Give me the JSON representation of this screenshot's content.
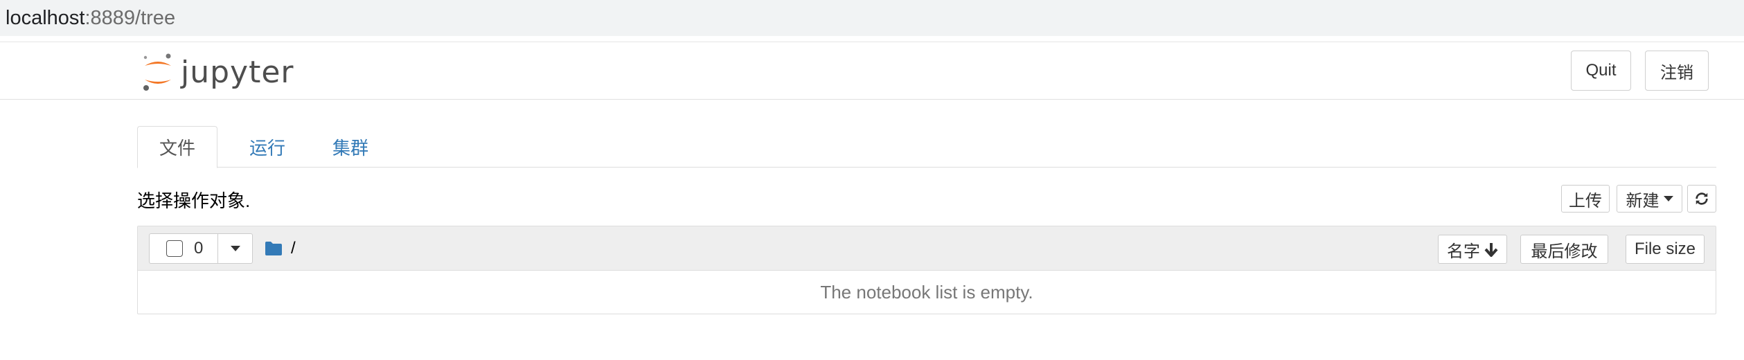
{
  "browser": {
    "url_host": "localhost",
    "url_rest": ":8889/tree"
  },
  "header": {
    "logo_text": "jupyter",
    "quit_label": "Quit",
    "logout_label": "注销"
  },
  "tabs": [
    {
      "label": "文件",
      "active": true
    },
    {
      "label": "运行",
      "active": false
    },
    {
      "label": "集群",
      "active": false
    }
  ],
  "toolbar": {
    "select_text": "选择操作对象.",
    "upload_label": "上传",
    "new_label": "新建",
    "refresh_icon": "refresh-icon"
  },
  "list": {
    "selected_count": "0",
    "breadcrumb_path": "/",
    "sort_name_label": "名字",
    "sort_modified_label": "最后修改",
    "sort_size_label": "File size",
    "empty_message": "The notebook list is empty."
  },
  "colors": {
    "link": "#337ab7",
    "jupyter_orange": "#f37726",
    "folder_blue": "#337ab7"
  }
}
